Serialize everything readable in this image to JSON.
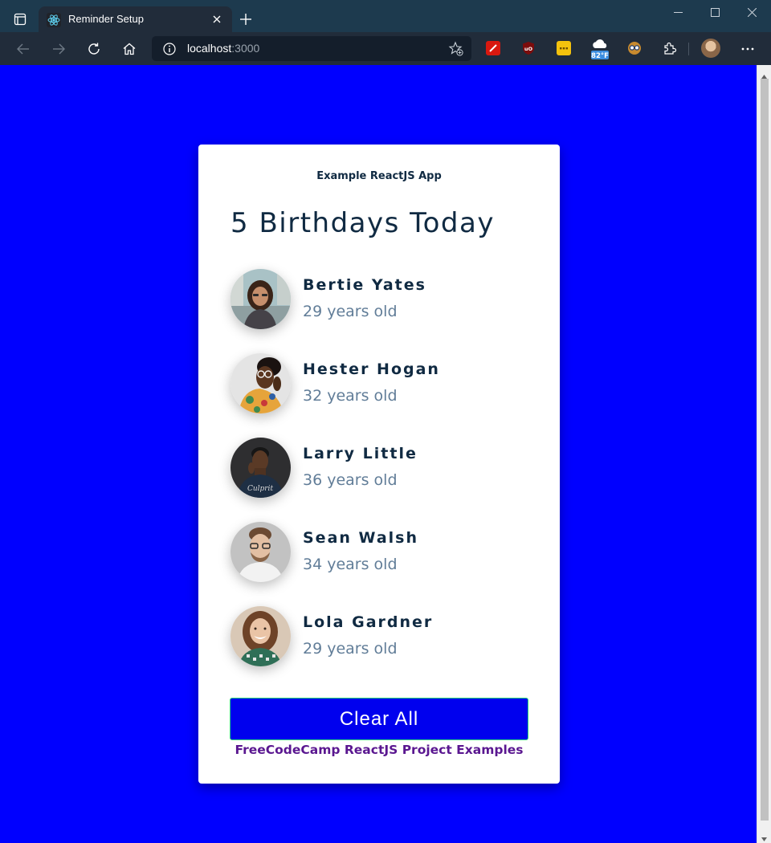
{
  "browser": {
    "tab": {
      "title": "Reminder Setup",
      "favicon": "react-logo-icon"
    },
    "address": {
      "host": "localhost",
      "port": ":3000"
    },
    "toolbar_icons": [
      "back-icon",
      "forward-icon",
      "refresh-icon",
      "home-icon",
      "info-icon",
      "favorites-add-icon"
    ],
    "extensions": [
      {
        "name": "red-pen-extension-icon",
        "color": "#d9180f"
      },
      {
        "name": "ublock-extension-icon",
        "color": "#7b0c0c"
      },
      {
        "name": "yellow-notes-extension-icon",
        "color": "#f4c20d"
      },
      {
        "name": "weather-extension-icon",
        "label": "82°F",
        "color": "#3b8de0"
      },
      {
        "name": "glasses-extension-icon",
        "color": "#c78a2f"
      },
      {
        "name": "extensions-puzzle-icon"
      }
    ]
  },
  "app": {
    "label": "Example ReactJS App",
    "heading": "5 Birthdays Today",
    "people": [
      {
        "name": "Bertie Yates",
        "age": "29 years old",
        "avatar": "bertie-yates-avatar"
      },
      {
        "name": "Hester Hogan",
        "age": "32 years old",
        "avatar": "hester-hogan-avatar"
      },
      {
        "name": "Larry Little",
        "age": "36 years old",
        "avatar": "larry-little-avatar"
      },
      {
        "name": "Sean Walsh",
        "age": "34 years old",
        "avatar": "sean-walsh-avatar"
      },
      {
        "name": "Lola Gardner",
        "age": "29 years old",
        "avatar": "lola-gardner-avatar"
      }
    ],
    "clear_button": "Clear All",
    "footer_link": "FreeCodeCamp ReactJS Project Examples"
  },
  "colors": {
    "page_background": "#0000ff",
    "button_background": "#0000ee",
    "heading_text": "#102a42",
    "secondary_text": "#617d98",
    "link_text": "#5a1790"
  }
}
